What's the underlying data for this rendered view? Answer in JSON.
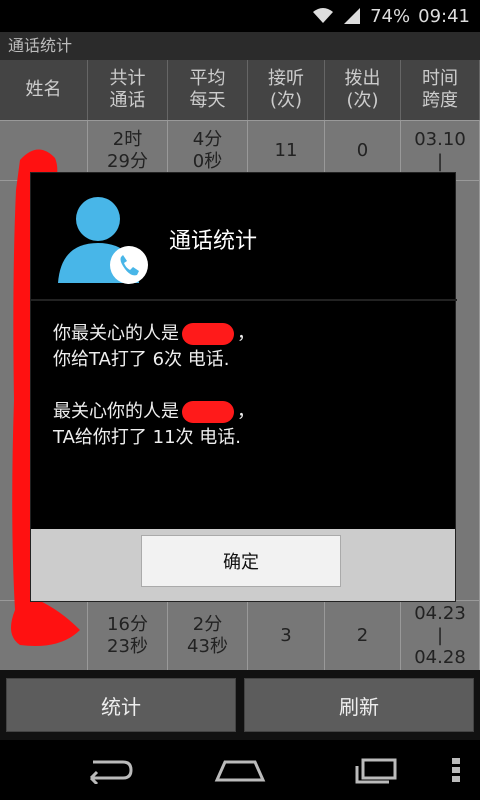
{
  "status": {
    "battery": "74%",
    "time": "09:41"
  },
  "app": {
    "title": "通话统计"
  },
  "table": {
    "headers": [
      "姓名",
      "共计\n通话",
      "平均\n每天",
      "接听\n(次)",
      "拨出\n(次)",
      "时间\n跨度"
    ],
    "rows": [
      {
        "name": "",
        "total": "2时\n29分",
        "avg": "4分\n0秒",
        "in": "11",
        "out": "0",
        "span": "03.10\n|"
      },
      {
        "name": "",
        "total": "16分\n23秒",
        "avg": "2分\n43秒",
        "in": "3",
        "out": "2",
        "span": "04.23\n|\n04.28"
      }
    ]
  },
  "dialog": {
    "title": "通话统计",
    "line1a": "你最关心的人是",
    "line1b": "，",
    "line2": "你给TA打了 6次 电话.",
    "line3a": "最关心你的人是",
    "line3b": "，",
    "line4": "TA给你打了 11次 电话.",
    "ok_label": "确定"
  },
  "buttons": {
    "stats_label": "统计",
    "refresh_label": "刷新"
  },
  "icons": {
    "wifi": "wifi-icon",
    "signal": "signal-icon",
    "contact": "contact-phone-icon",
    "back": "back-icon",
    "home": "home-icon",
    "recents": "recents-icon",
    "menu": "menu-icon"
  }
}
